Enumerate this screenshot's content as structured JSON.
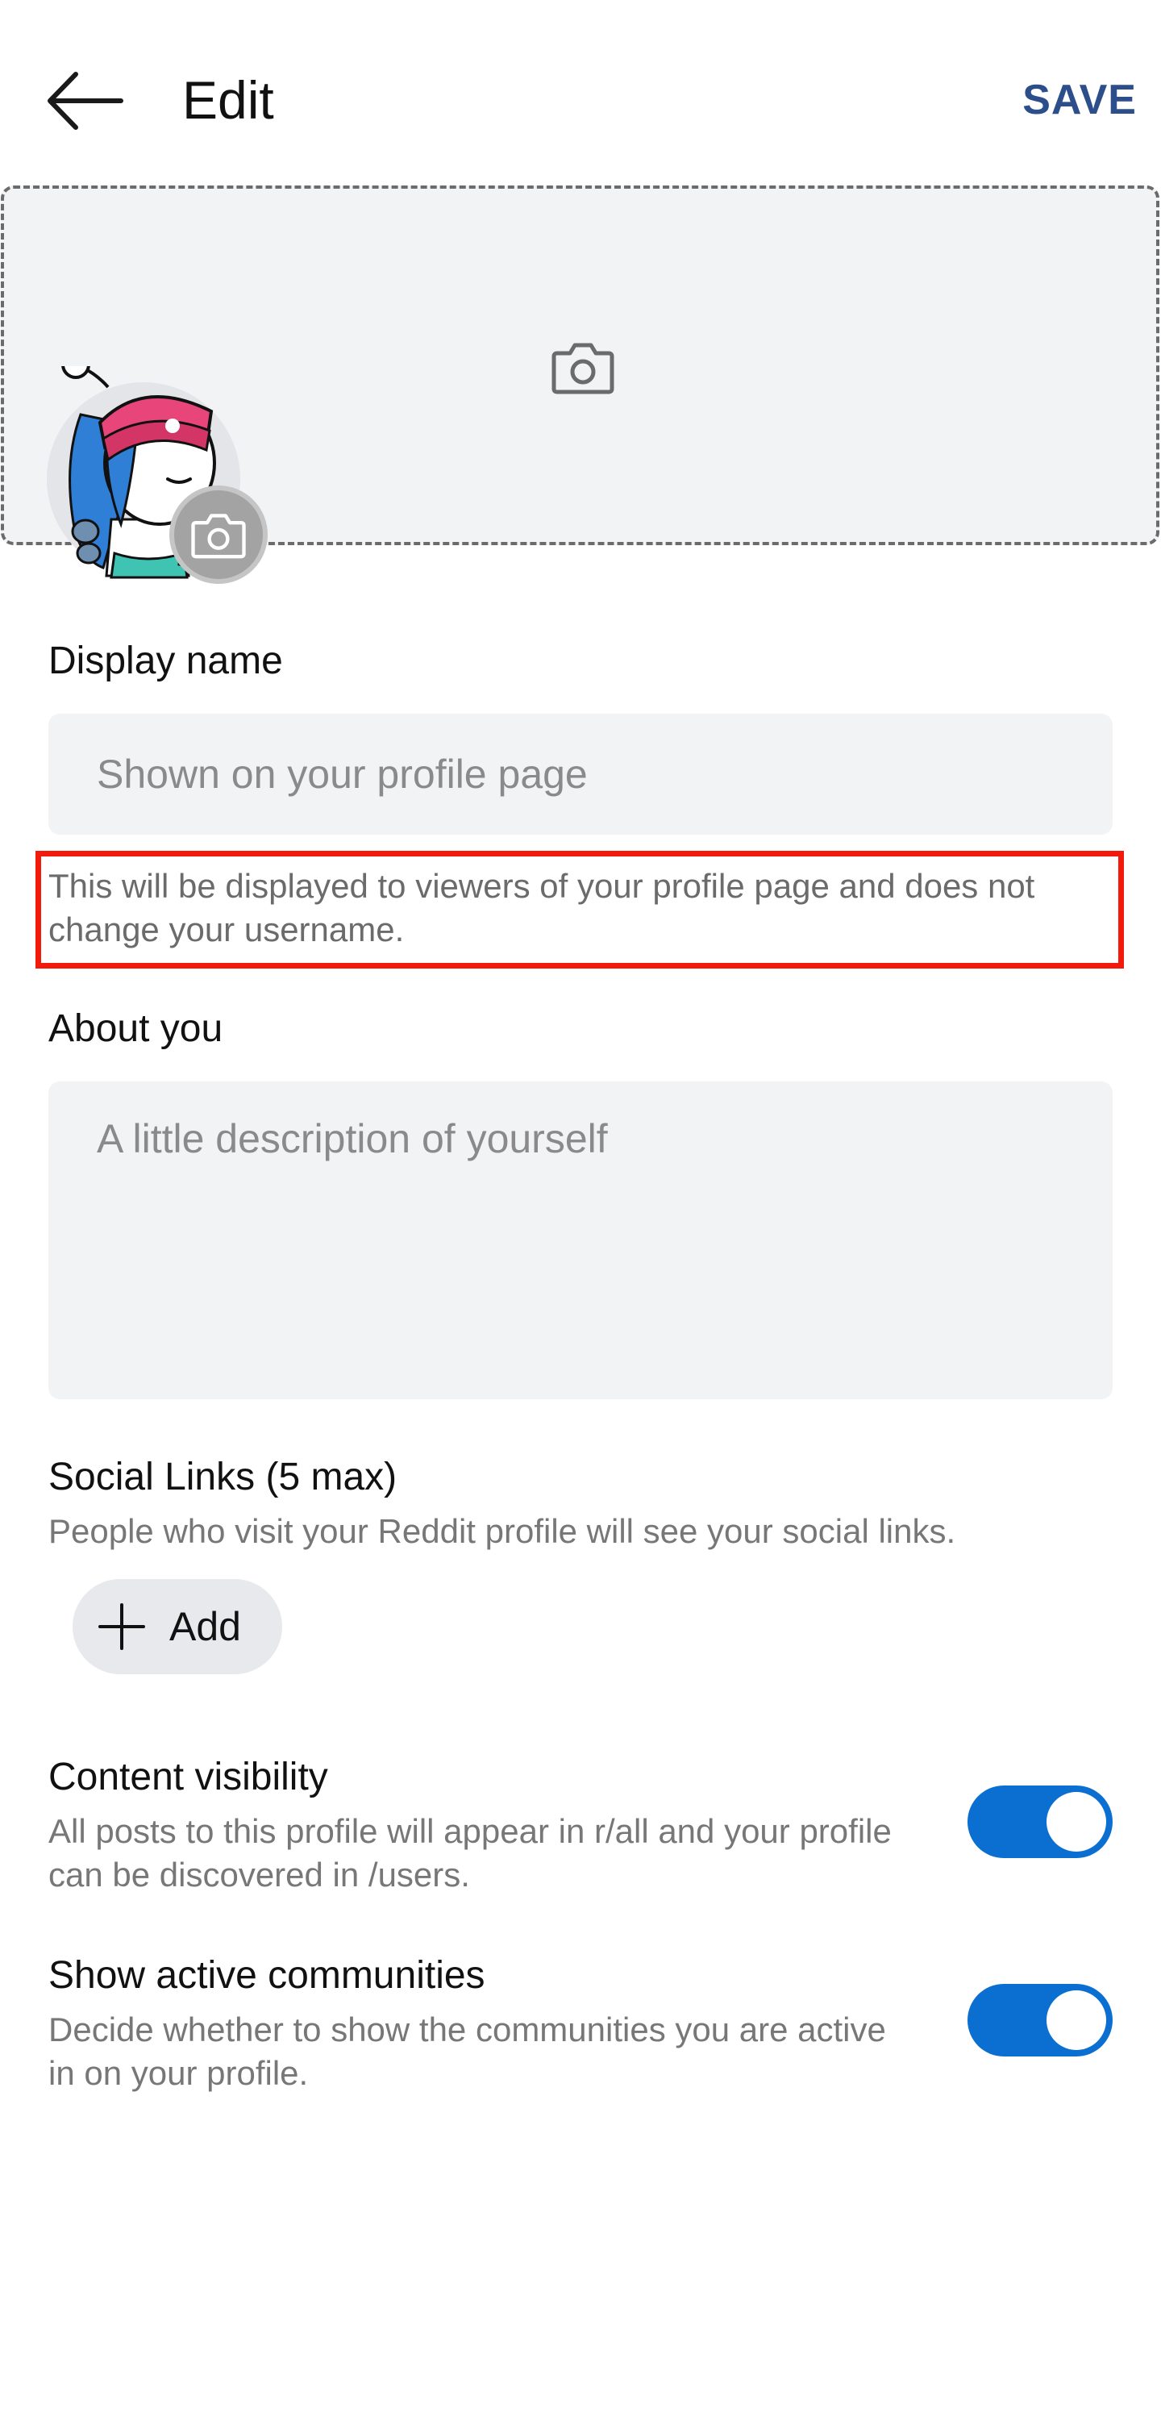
{
  "header": {
    "title": "Edit",
    "save_label": "SAVE"
  },
  "banner": {
    "camera_icon": "camera-icon"
  },
  "avatar": {
    "camera_icon": "camera-icon"
  },
  "display_name": {
    "label": "Display name",
    "value": "",
    "placeholder": "Shown on your profile page",
    "helper": "This will be displayed to viewers of your profile page and does not change your username."
  },
  "about": {
    "label": "About you",
    "value": "",
    "placeholder": "A little description of yourself"
  },
  "social_links": {
    "label": "Social Links (5 max)",
    "description": "People who visit your Reddit profile will see your social links.",
    "add_label": "Add"
  },
  "content_visibility": {
    "label": "Content visibility",
    "description": "All posts to this profile will appear in r/all and your profile can be discovered in /users.",
    "enabled": true
  },
  "active_communities": {
    "label": "Show active communities",
    "description": "Decide whether to show the communities you are active in on your profile.",
    "enabled": true
  },
  "colors": {
    "accent": "#0a6fd1",
    "save": "#2c4e8a",
    "highlight_box": "#f21a0a"
  }
}
